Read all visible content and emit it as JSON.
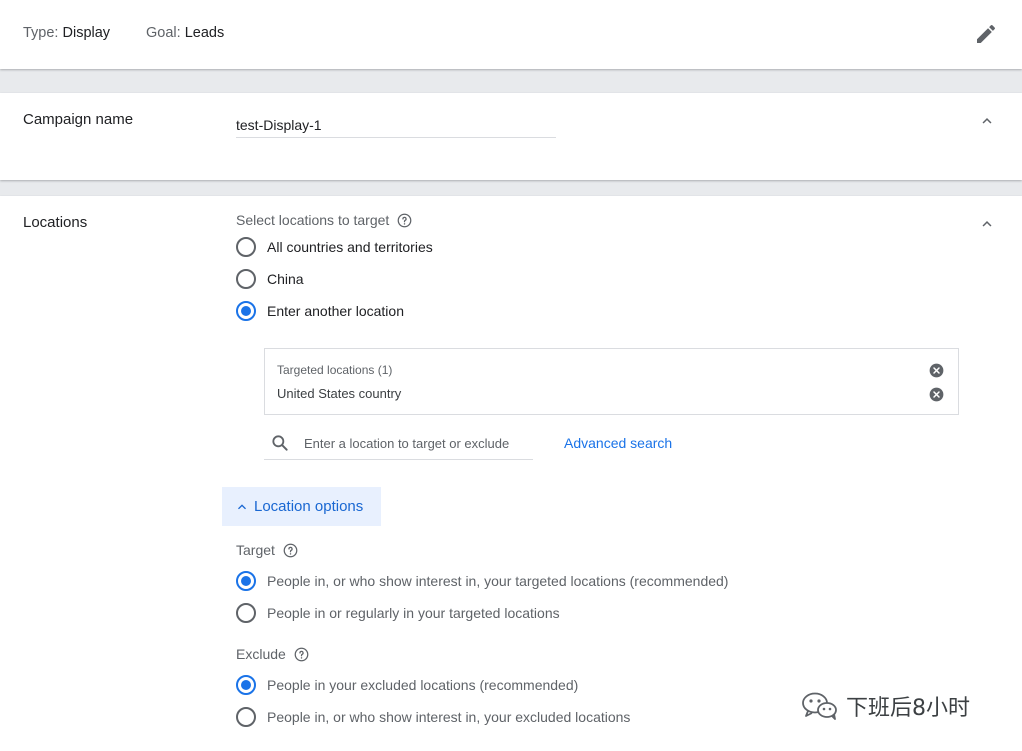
{
  "summary": {
    "type_label": "Type:",
    "type_value": "Display",
    "goal_label": "Goal:",
    "goal_value": "Leads",
    "edit_icon": "pencil-icon"
  },
  "campaign_name": {
    "title": "Campaign name",
    "value": "test-Display-1",
    "collapse_icon": "chevron-up-icon"
  },
  "locations": {
    "title": "Locations",
    "select_label": "Select locations to target",
    "options": [
      {
        "label": "All countries and territories",
        "selected": false
      },
      {
        "label": "China",
        "selected": false
      },
      {
        "label": "Enter another location",
        "selected": true
      }
    ],
    "targeted_header": "Targeted locations (1)",
    "targeted_items": [
      "United States country"
    ],
    "search_placeholder": "Enter a location to target or exclude",
    "advanced_search": "Advanced search",
    "location_options_label": "Location options",
    "target_label": "Target",
    "target_options": [
      {
        "label": "People in, or who show interest in, your targeted locations (recommended)",
        "selected": true
      },
      {
        "label": "People in or regularly in your targeted locations",
        "selected": false
      }
    ],
    "exclude_label": "Exclude",
    "exclude_options": [
      {
        "label": "People in your excluded locations (recommended)",
        "selected": true
      },
      {
        "label": "People in, or who show interest in, your excluded locations",
        "selected": false
      }
    ]
  },
  "watermark": {
    "text": "下班后8小时"
  },
  "colors": {
    "accent": "#1a73e8",
    "chip_bg": "#e8f0fe",
    "page_bg": "#e8eaed"
  }
}
